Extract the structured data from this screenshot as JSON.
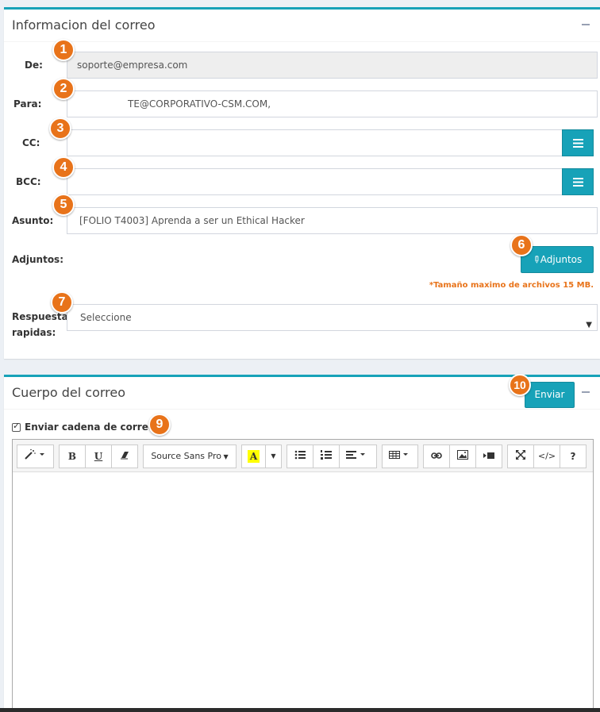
{
  "info_panel": {
    "title": "Informacion del correo",
    "from_label": "De:",
    "from_value": "soporte@empresa.com",
    "to_label": "Para:",
    "to_value": "TE@CORPORATIVO-CSM.COM,",
    "cc_label": "CC:",
    "cc_value": "",
    "bcc_label": "BCC:",
    "bcc_value": "",
    "subject_label": "Asunto:",
    "subject_value": "[FOLIO T4003] Aprenda a ser un Ethical Hacker",
    "attachments_label": "Adjuntos:",
    "attachments_button": "Adjuntos",
    "size_note": "*Tamaño maximo de archivos 15 MB.",
    "quick_reply_label_line1": "Respuesta",
    "quick_reply_label_line2": "rapidas:",
    "quick_reply_value": "Seleccione"
  },
  "body_panel": {
    "title": "Cuerpo del correo",
    "send_button": "Enviar",
    "chain_checkbox_label": "Enviar cadena de correos",
    "chain_checked": true,
    "toolbar": {
      "font_name": "Source Sans Pro",
      "bold": "B",
      "underline": "U",
      "highlight": "A",
      "help": "?",
      "code": "</>"
    }
  },
  "markers": [
    "1",
    "2",
    "3",
    "4",
    "5",
    "6",
    "7",
    "9",
    "10"
  ],
  "colors": {
    "accent": "#17a2b8",
    "marker": "#e8731a",
    "note": "#e8731a"
  }
}
